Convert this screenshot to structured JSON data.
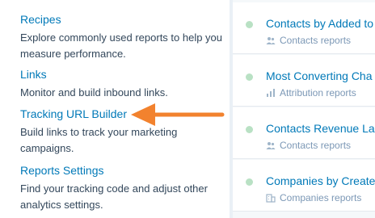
{
  "menu": {
    "items": [
      {
        "label": "Recipes",
        "description": "Explore commonly used reports to help you measure performance."
      },
      {
        "label": "Links",
        "description": "Monitor and build inbound links."
      },
      {
        "label": "Tracking URL Builder",
        "description": "Build links to track your marketing campaigns."
      },
      {
        "label": "Reports Settings",
        "description": "Find your tracking code and adjust other analytics settings."
      }
    ]
  },
  "reports": [
    {
      "title": "Contacts by Added to",
      "subtitle": "Contacts reports",
      "icon": "people-icon"
    },
    {
      "title": "Most Converting Cha",
      "subtitle": "Attribution reports",
      "icon": "bar-chart-icon"
    },
    {
      "title": "Contacts Revenue La",
      "subtitle": "Contacts reports",
      "icon": "people-icon"
    },
    {
      "title": "Companies by Create",
      "subtitle": "Companies reports",
      "icon": "building-icon"
    }
  ],
  "colors": {
    "link": "#0079b8",
    "text": "#33475b",
    "muted": "#7c98b6",
    "status_dot": "#b9e1c4",
    "arrow": "#f2822e"
  }
}
